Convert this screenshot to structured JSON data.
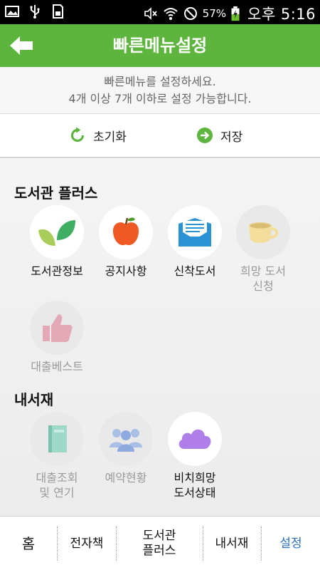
{
  "status_bar": {
    "battery_percent": "57%",
    "time": "오후 5:16"
  },
  "header": {
    "title": "빠른메뉴설정",
    "back_icon": "back-arrow-icon",
    "color": "#5db53e"
  },
  "info": {
    "line1": "빠른메뉴를 설정하세요.",
    "line2": "4개 이상 7개 이하로 설정 가능합니다."
  },
  "actions": {
    "reset": {
      "label": "초기화",
      "icon": "refresh-icon"
    },
    "save": {
      "label": "저장",
      "icon": "arrow-right-circle-icon"
    }
  },
  "sections": [
    {
      "title": "도서관 플러스",
      "items": [
        {
          "label": "도서관정보",
          "icon": "leaves-icon",
          "enabled": true
        },
        {
          "label": "공지사항",
          "icon": "apple-icon",
          "enabled": true
        },
        {
          "label": "신착도서",
          "icon": "envelope-icon",
          "enabled": true
        },
        {
          "label": "희망 도서\n신청",
          "icon": "cup-icon",
          "enabled": false
        },
        {
          "label": "대출베스트",
          "icon": "thumbs-up-icon",
          "enabled": false
        }
      ]
    },
    {
      "title": "내서재",
      "items": [
        {
          "label": "대출조회\n및 연기",
          "icon": "book-icon",
          "enabled": false
        },
        {
          "label": "예약현황",
          "icon": "people-icon",
          "enabled": false
        },
        {
          "label": "비치희망\n도서상태",
          "icon": "cloud-icon",
          "enabled": true
        }
      ]
    }
  ],
  "bottom_nav": [
    {
      "label": "홈",
      "active": false
    },
    {
      "label": "전자책",
      "active": false
    },
    {
      "label": "도서관\n플러스",
      "active": false
    },
    {
      "label": "내서재",
      "active": false
    },
    {
      "label": "설정",
      "active": true
    }
  ],
  "colors": {
    "accent_green": "#5db53e",
    "active_nav": "#2b6fbf"
  }
}
